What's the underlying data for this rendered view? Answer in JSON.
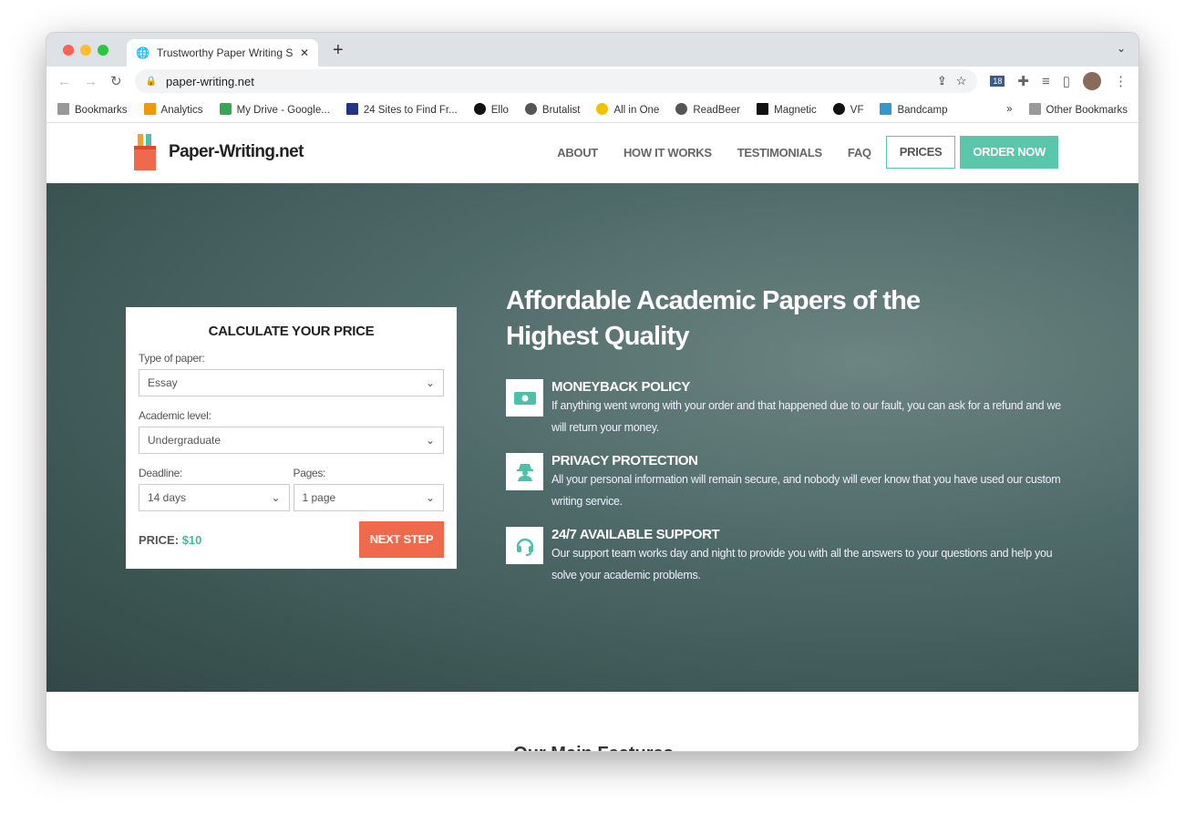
{
  "browser": {
    "tab_title": "Trustworthy Paper Writing Serv",
    "url": "paper-writing.net",
    "bookmarks": [
      "Bookmarks",
      "Analytics",
      "My Drive - Google...",
      "24 Sites to Find Fr...",
      "Ello",
      "Brutalist",
      "All in One",
      "ReadBeer",
      "Magnetic",
      "VF",
      "Bandcamp"
    ],
    "more": "»",
    "other_bookmarks": "Other Bookmarks",
    "ext_badge": "18"
  },
  "site": {
    "brand": "Paper-Writing.net",
    "nav": [
      "ABOUT",
      "HOW IT WORKS",
      "TESTIMONIALS",
      "FAQ"
    ],
    "prices": "PRICES",
    "order": "ORDER NOW",
    "accent": "#5ac7ad",
    "cta": "#ef6a4c"
  },
  "calculator": {
    "title": "CALCULATE YOUR PRICE",
    "type_label": "Type of paper:",
    "type_value": "Essay",
    "level_label": "Academic level:",
    "level_value": "Undergraduate",
    "deadline_label": "Deadline:",
    "deadline_value": "14 days",
    "pages_label": "Pages:",
    "pages_value": "1 page",
    "price_label": "PRICE:",
    "price_value": "$10",
    "next": "NEXT STEP"
  },
  "hero": {
    "headline": "Affordable Academic Papers of the Highest Quality",
    "features": [
      {
        "icon": "money-icon",
        "title": "MONEYBACK POLICY",
        "text": "If anything went wrong with your order and that happened due to our fault, you can ask for a refund and we will return your money."
      },
      {
        "icon": "spy-icon",
        "title": "PRIVACY PROTECTION",
        "text": "All your personal information will remain secure, and nobody will ever know that you have used our custom writing service."
      },
      {
        "icon": "headset-icon",
        "title": "24/7 AVAILABLE SUPPORT",
        "text": "Our support team works day and night to provide you with all the answers to your questions and help you solve your academic problems."
      }
    ]
  },
  "section_title": "Our Main Features"
}
